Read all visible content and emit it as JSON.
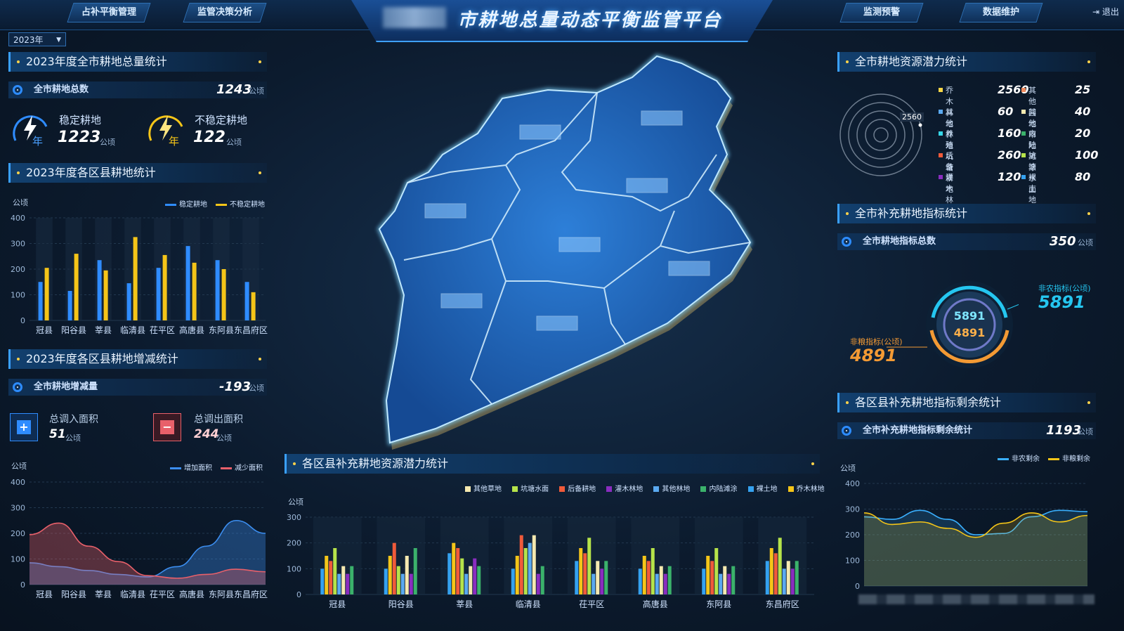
{
  "header": {
    "title": "市耕地总量动态平衡监管平台",
    "nav_left": [
      "占补平衡管理",
      "监管决策分析"
    ],
    "nav_right": [
      "监测预警",
      "数据维护"
    ],
    "logout": "退出"
  },
  "year_select": "2023年",
  "total": {
    "panel_title": "2023年度全市耕地总量统计",
    "label": "全市耕地总数",
    "value": "1243",
    "unit": "公顷",
    "stable_label": "稳定耕地",
    "stable_value": "1223",
    "unstable_label": "不稳定耕地",
    "unstable_value": "122",
    "year_char": "年"
  },
  "county_chart": {
    "panel_title": "2023年度各区县耕地统计",
    "unit": "公顷",
    "legend": [
      "稳定耕地",
      "不稳定耕地"
    ]
  },
  "change": {
    "panel_title": "2023年度各区县耕地增减统计",
    "label": "全市耕地增减量",
    "value": "-193",
    "unit": "公顷",
    "in_label": "总调入面积",
    "in_value": "51",
    "out_label": "总调出面积",
    "out_value": "244",
    "chart_unit": "公顷",
    "legend": [
      "增加面积",
      "减少面积"
    ]
  },
  "potential": {
    "panel_title": "全市耕地资源潜力统计",
    "radar_value": "2560",
    "items": [
      {
        "name": "乔木林地",
        "value": "2560",
        "color": "#f5d547"
      },
      {
        "name": "其他园地",
        "value": "25",
        "color": "#f08a5d"
      },
      {
        "name": "其他林地",
        "value": "60",
        "color": "#5aa9f0"
      },
      {
        "name": "其他草地",
        "value": "40",
        "color": "#f5e9b0"
      },
      {
        "name": "养殖坑塘",
        "value": "160",
        "color": "#37d7e8"
      },
      {
        "name": "内陆滩涂",
        "value": "20",
        "color": "#3bb26b"
      },
      {
        "name": "后备耕地",
        "value": "260",
        "color": "#f05a3a"
      },
      {
        "name": "坑塘水面",
        "value": "100",
        "color": "#b6e34a"
      },
      {
        "name": "灌木林地",
        "value": "120",
        "color": "#8a2dbf"
      },
      {
        "name": "裸土地",
        "value": "80",
        "color": "#35a2f0"
      }
    ]
  },
  "supplement": {
    "panel_title": "全市补充耕地指标统计",
    "label": "全市耕地指标总数",
    "value": "350",
    "unit": "公顷",
    "nonagri_label": "非农指标(公顷)",
    "nonagri_value": "5891",
    "nongrain_label": "非粮指标(公顷)",
    "nongrain_value": "4891",
    "ring_top": "5891",
    "ring_bottom": "4891"
  },
  "remain": {
    "panel_title": "各区县补充耕地指标剩余统计",
    "label": "全市补充耕地指标剩余统计",
    "value": "1193",
    "unit": "公顷",
    "chart_unit": "公顷",
    "legend": [
      "非农剩余",
      "非粮剩余"
    ]
  },
  "county_potential": {
    "panel_title": "各区县补充耕地资源潜力统计",
    "unit": "公顷",
    "legend": [
      "其他草地",
      "坑塘水面",
      "后备耕地",
      "灌木林地",
      "其他林地",
      "内陆滩涂",
      "裸土地",
      "乔木林地"
    ]
  },
  "chart_data": [
    {
      "type": "bar",
      "title": "2023年度各区县耕地统计",
      "ylabel": "公顷",
      "ylim": [
        0,
        400
      ],
      "yticks": [
        0,
        100,
        200,
        300,
        400
      ],
      "categories": [
        "冠县",
        "阳谷县",
        "莘县",
        "临清县",
        "茌平区",
        "高唐县",
        "东阿县",
        "东昌府区"
      ],
      "series": [
        {
          "name": "稳定耕地",
          "color": "#2f8cff",
          "values": [
            150,
            115,
            235,
            145,
            205,
            290,
            235,
            150
          ]
        },
        {
          "name": "不稳定耕地",
          "color": "#f5c518",
          "values": [
            205,
            260,
            195,
            325,
            255,
            225,
            200,
            110
          ]
        }
      ]
    },
    {
      "type": "area",
      "title": "2023年度各区县耕地增减统计",
      "ylabel": "公顷",
      "ylim": [
        0,
        400
      ],
      "yticks": [
        0,
        100,
        200,
        300,
        400
      ],
      "categories": [
        "冠县",
        "阳谷县",
        "莘县",
        "临清县",
        "茌平区",
        "高唐县",
        "东阿县",
        "东昌府区"
      ],
      "series": [
        {
          "name": "增加面积",
          "color": "#3c8ef0",
          "values": [
            85,
            70,
            55,
            40,
            30,
            70,
            150,
            250,
            200
          ]
        },
        {
          "name": "减少面积",
          "color": "#e8606a",
          "values": [
            195,
            240,
            150,
            90,
            35,
            25,
            40,
            60,
            50
          ]
        }
      ]
    },
    {
      "type": "bar",
      "title": "各区县补充耕地资源潜力统计",
      "ylabel": "公顷",
      "ylim": [
        0,
        300
      ],
      "yticks": [
        0,
        100,
        200,
        300
      ],
      "categories": [
        "冠县",
        "阳谷县",
        "莘县",
        "临清县",
        "茌平区",
        "高唐县",
        "东阿县",
        "东昌府区"
      ],
      "series": [
        {
          "name": "裸土地",
          "color": "#35a2f0",
          "values": [
            100,
            100,
            160,
            100,
            130,
            100,
            100,
            130
          ]
        },
        {
          "name": "乔木林地",
          "color": "#f5c518",
          "values": [
            150,
            150,
            200,
            150,
            180,
            150,
            150,
            180
          ]
        },
        {
          "name": "后备耕地",
          "color": "#f05a3a",
          "values": [
            130,
            200,
            180,
            230,
            160,
            130,
            130,
            160
          ]
        },
        {
          "name": "坑塘水面",
          "color": "#b6e34a",
          "values": [
            180,
            110,
            140,
            180,
            220,
            180,
            180,
            220
          ]
        },
        {
          "name": "其他林地",
          "color": "#5aa9f0",
          "values": [
            80,
            80,
            80,
            200,
            80,
            80,
            80,
            100
          ]
        },
        {
          "name": "其他草地",
          "color": "#f5e9b0",
          "values": [
            110,
            150,
            110,
            230,
            130,
            110,
            110,
            130
          ]
        },
        {
          "name": "灌木林地",
          "color": "#8a2dbf",
          "values": [
            80,
            80,
            140,
            80,
            100,
            80,
            80,
            100
          ]
        },
        {
          "name": "内陆滩涂",
          "color": "#3bb26b",
          "values": [
            110,
            180,
            110,
            110,
            130,
            110,
            110,
            130
          ]
        }
      ]
    },
    {
      "type": "area",
      "title": "各区县补充耕地指标剩余统计",
      "ylabel": "公顷",
      "ylim": [
        0,
        400
      ],
      "yticks": [
        0,
        100,
        200,
        300,
        400
      ],
      "x": [
        0,
        1,
        2,
        3,
        4,
        5,
        6,
        7,
        8
      ],
      "series": [
        {
          "name": "非农剩余",
          "color": "#3ab0ff",
          "values": [
            270,
            260,
            295,
            260,
            200,
            205,
            270,
            295,
            290
          ]
        },
        {
          "name": "非粮剩余",
          "color": "#f5c518",
          "values": [
            285,
            240,
            250,
            225,
            190,
            245,
            285,
            250,
            275
          ]
        }
      ]
    }
  ]
}
